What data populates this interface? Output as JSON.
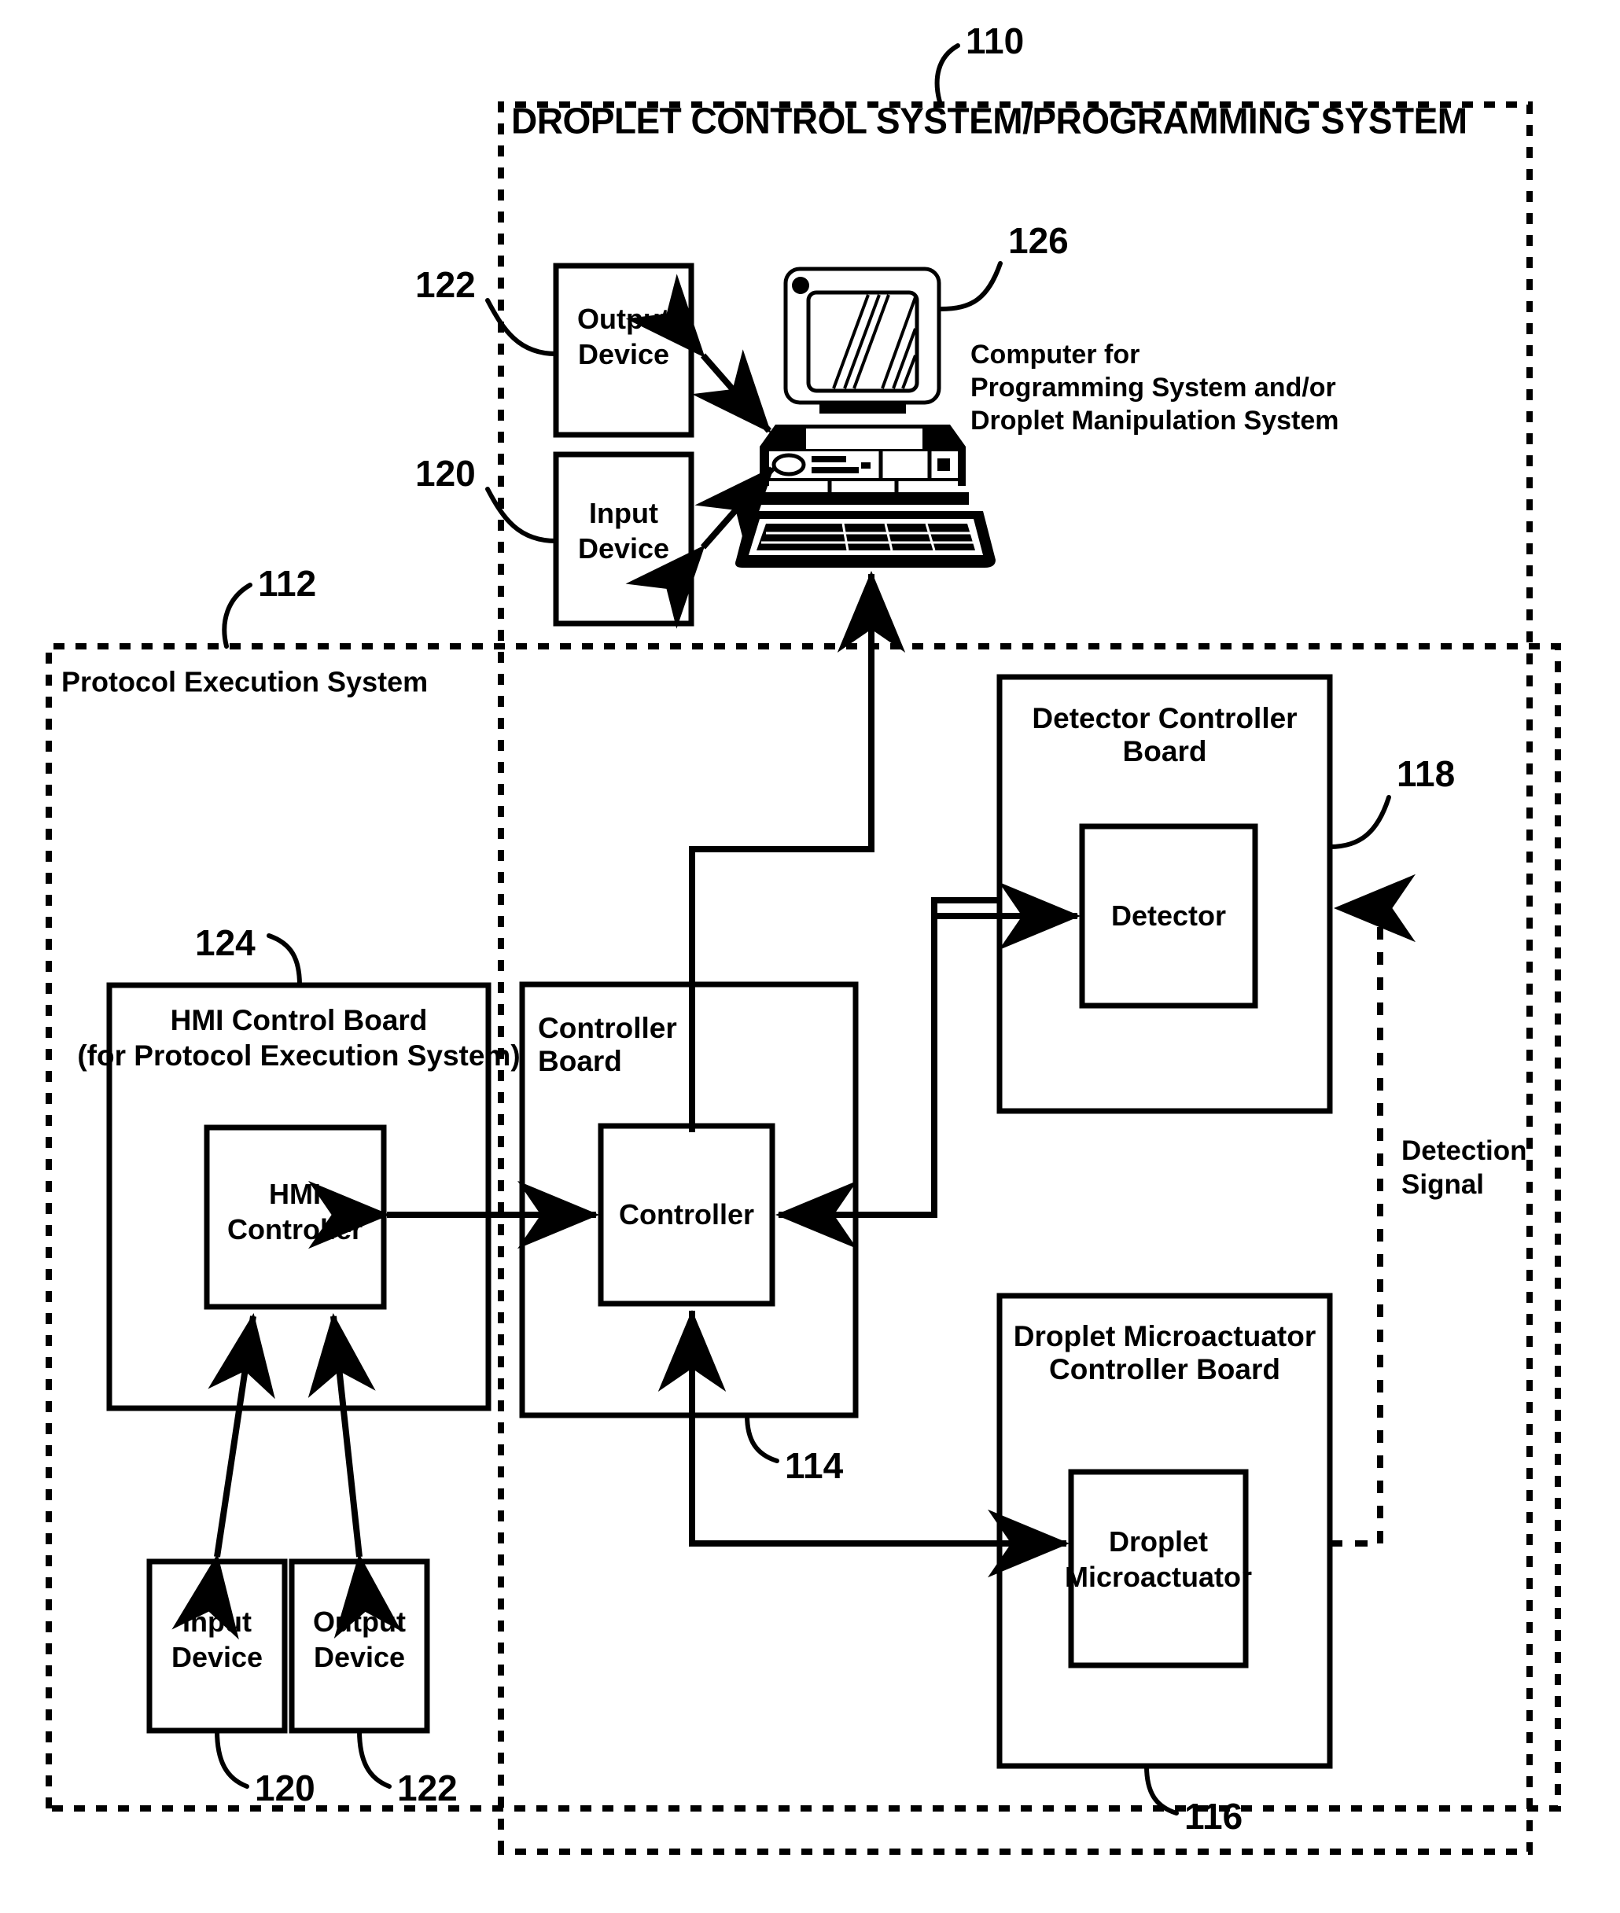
{
  "figure": {
    "outer_system": {
      "ref": "110",
      "title": "DROPLET CONTROL SYSTEM/PROGRAMMING SYSTEM"
    },
    "inner_system": {
      "ref": "112",
      "title": "Protocol Execution System"
    },
    "computer": {
      "ref": "126",
      "caption_line1": "Computer for",
      "caption_line2": "Programming System and/or",
      "caption_line3": "Droplet Manipulation System"
    },
    "top_devices": [
      {
        "ref": "122",
        "label_line1": "Output",
        "label_line2": "Device"
      },
      {
        "ref": "120",
        "label_line1": "Input",
        "label_line2": "Device"
      }
    ],
    "boards": [
      {
        "ref": "124",
        "title_line1": "HMI Control Board",
        "title_line2": "(for Protocol Execution System)",
        "inner_line1": "HMI",
        "inner_line2": "Controller"
      },
      {
        "ref": "114",
        "title_line1": "Controller",
        "title_line2": "Board",
        "inner_line1": "Controller",
        "inner_line2": ""
      },
      {
        "ref": "118",
        "title_line1": "Detector Controller",
        "title_line2": "Board",
        "inner_line1": "Detector",
        "inner_line2": ""
      },
      {
        "ref": "116",
        "title_line1": "Droplet Microactuator",
        "title_line2": "Controller Board",
        "inner_line1": "Droplet",
        "inner_line2": "Microactuator"
      }
    ],
    "bottom_devices": [
      {
        "ref": "120",
        "label_line1": "Input",
        "label_line2": "Device"
      },
      {
        "ref": "122",
        "label_line1": "Output",
        "label_line2": "Device"
      }
    ],
    "signals": [
      {
        "name": "detection-signal",
        "label_line1": "Detection",
        "label_line2": "Signal"
      }
    ],
    "colors": {
      "ink": "#000000",
      "background": "#ffffff"
    }
  }
}
